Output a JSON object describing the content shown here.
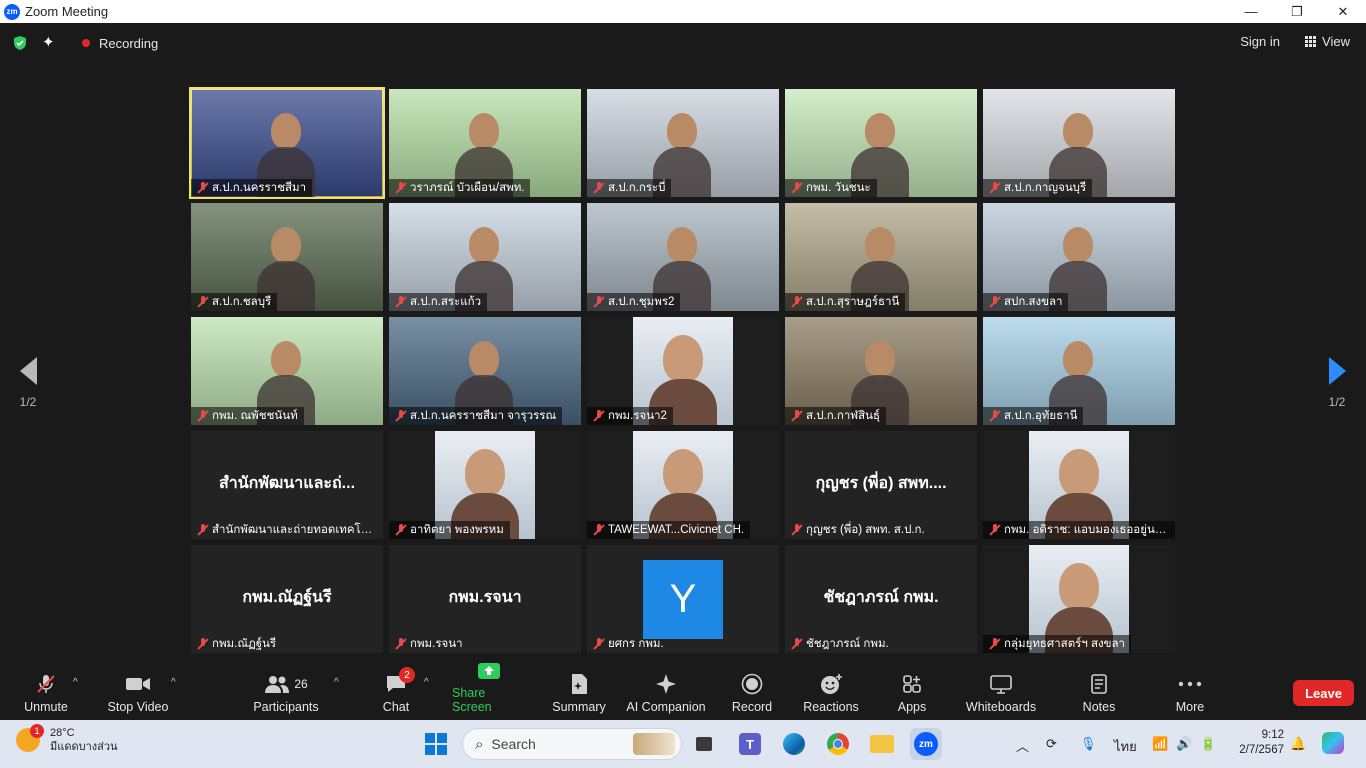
{
  "window": {
    "title": "Zoom Meeting",
    "logo": "zm",
    "controls": [
      "—",
      "❐",
      "✕"
    ]
  },
  "meeting_bar": {
    "recording_label": "Recording",
    "signin_label": "Sign in",
    "view_label": "View"
  },
  "paging": {
    "left": "1/2",
    "right": "1/2"
  },
  "tiles": [
    {
      "name": "ส.ป.ก.นครราชสีมา",
      "kind": "video",
      "bg": "#3a4d8f"
    },
    {
      "name": "วราภรณ์ บัวเผือน/สพท.",
      "kind": "video",
      "bg": "#b7e0a6"
    },
    {
      "name": "ส.ป.ก.กระบี่",
      "kind": "video",
      "bg": "#c9d3dc"
    },
    {
      "name": "กพม. วันชนะ",
      "kind": "video",
      "bg": "#c6e8b9"
    },
    {
      "name": "ส.ป.ก.กาญจนบุรี",
      "kind": "video",
      "bg": "#d9dde2"
    },
    {
      "name": "ส.ป.ก.ชลบุรี",
      "kind": "video",
      "bg": "#5c6e54"
    },
    {
      "name": "ส.ป.ก.สระแก้ว",
      "kind": "video",
      "bg": "#c8d4df"
    },
    {
      "name": "ส.ป.ก.ชุมพร2",
      "kind": "video",
      "bg": "#a9b4bf"
    },
    {
      "name": "ส.ป.ก.สุราษฎร์ธานี",
      "kind": "video",
      "bg": "#b0a88c"
    },
    {
      "name": "สปก.สงขลา",
      "kind": "video",
      "bg": "#b9c8d6"
    },
    {
      "name": "กพม. ณพัชชนันท์",
      "kind": "video",
      "bg": "#bde3b0"
    },
    {
      "name": "ส.ป.ก.นครราชสีมา จารุวรรณ",
      "kind": "video",
      "bg": "#4d6a86"
    },
    {
      "name": "กพม.รจนา2",
      "kind": "video",
      "bg": "#1e1e1e"
    },
    {
      "name": "ส.ป.ก.กาฬสินธุ์",
      "kind": "video",
      "bg": "#8a7d63"
    },
    {
      "name": "ส.ป.ก.อุทัยธานี",
      "kind": "video",
      "bg": "#a7d2e8"
    },
    {
      "name": "สำนักพัฒนาและถ่ายทอดเทคโนโลยี",
      "kind": "text",
      "display": "สำนักพัฒนาและถ่...",
      "bg": "#232323"
    },
    {
      "name": "อาทิตยา พองพรหม",
      "kind": "video",
      "bg": "#1e1e1e"
    },
    {
      "name": "TAWEEWAT...Civicnet CH.",
      "kind": "video",
      "bg": "#1e1e1e"
    },
    {
      "name": "กุญชร (พี่อ) สพท. ส.ป.ก.",
      "kind": "text",
      "display": "กุญชร (พี่อ) สพท....",
      "bg": "#232323"
    },
    {
      "name": "กพม. อดิราช: แอบมองเธออยู่นะจ๊ะ",
      "kind": "video",
      "bg": "#1e1e1e"
    },
    {
      "name": "กพม.ณัฏฐ์นรี",
      "kind": "text",
      "display": "กพม.ณัฏฐ์นรี",
      "bg": "#232323"
    },
    {
      "name": "กพม.รจนา",
      "kind": "text",
      "display": "กพม.รจนา",
      "bg": "#232323"
    },
    {
      "name": "ยศกร กพม.",
      "kind": "avatar",
      "letter": "Y",
      "bg": "#232323"
    },
    {
      "name": "ชัชฎาภรณ์ กพม.",
      "kind": "text",
      "display": "ชัชฎาภรณ์ กพม.",
      "bg": "#232323"
    },
    {
      "name": "กลุ่มยุทธศาสตร์ฯ สงขลา",
      "kind": "video",
      "bg": "#1e1e1e"
    }
  ],
  "toolbar": {
    "unmute": "Unmute",
    "stop_video": "Stop Video",
    "participants": "Participants",
    "participants_count": "26",
    "chat": "Chat",
    "chat_badge": "2",
    "share_screen": "Share Screen",
    "summary": "Summary",
    "ai_companion": "AI Companion",
    "record": "Record",
    "reactions": "Reactions",
    "apps": "Apps",
    "whiteboards": "Whiteboards",
    "notes": "Notes",
    "more": "More",
    "leave": "Leave"
  },
  "taskbar": {
    "weather_temp": "28°C",
    "weather_desc": "มีแดดบางส่วน",
    "weather_badge": "1",
    "search_placeholder": "Search",
    "language": "ไทย",
    "time": "9:12",
    "date": "2/7/2567"
  },
  "colors": {
    "accent": "#0b5cff",
    "leave": "#e02828",
    "share": "#2ecc5a",
    "active_speaker": "#f1e26b"
  }
}
